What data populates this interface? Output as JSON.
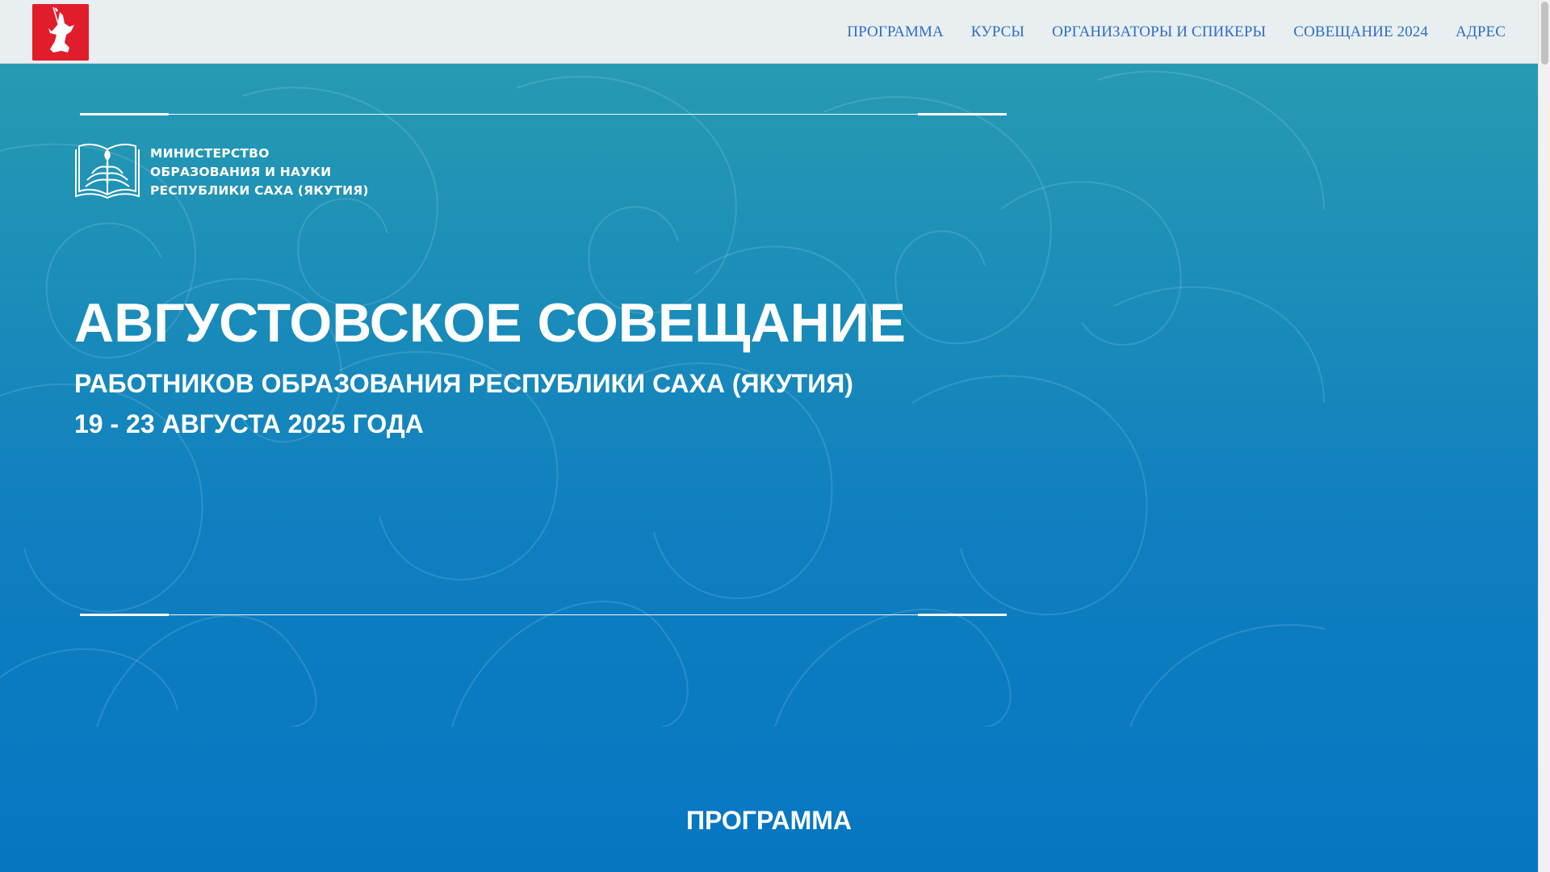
{
  "header": {
    "logo_icon": "motherland-monument-icon",
    "nav": [
      {
        "label": "ПРОГРАММА"
      },
      {
        "label": "КУРСЫ"
      },
      {
        "label": "ОРГАНИЗАТОРЫ И СПИКЕРЫ"
      },
      {
        "label": "СОВЕЩАНИЕ 2024"
      },
      {
        "label": "АДРЕС"
      }
    ]
  },
  "hero": {
    "ministry": {
      "emblem_icon": "open-book-emblem-icon",
      "lines": [
        "МИНИСТЕРСТВО",
        "ОБРАЗОВАНИЯ И НАУКИ",
        "РЕСПУБЛИКИ САХА (ЯКУТИЯ)"
      ]
    },
    "title": "АВГУСТОВСКОЕ СОВЕЩАНИЕ",
    "subtitle": "РАБОТНИКОВ ОБРАЗОВАНИЯ РЕСПУБЛИКИ САХА (ЯКУТИЯ)",
    "dates": "19 - 23 АВГУСТА 2025 ГОДА"
  },
  "section": {
    "title": "ПРОГРАММА"
  },
  "colors": {
    "header_bg": "#e9eef0",
    "nav_text": "#2a70c2",
    "logo_bg": "#e21d2b",
    "hero_top": "#2a9eb0",
    "hero_bottom": "#0676c2",
    "text": "#ffffff"
  }
}
